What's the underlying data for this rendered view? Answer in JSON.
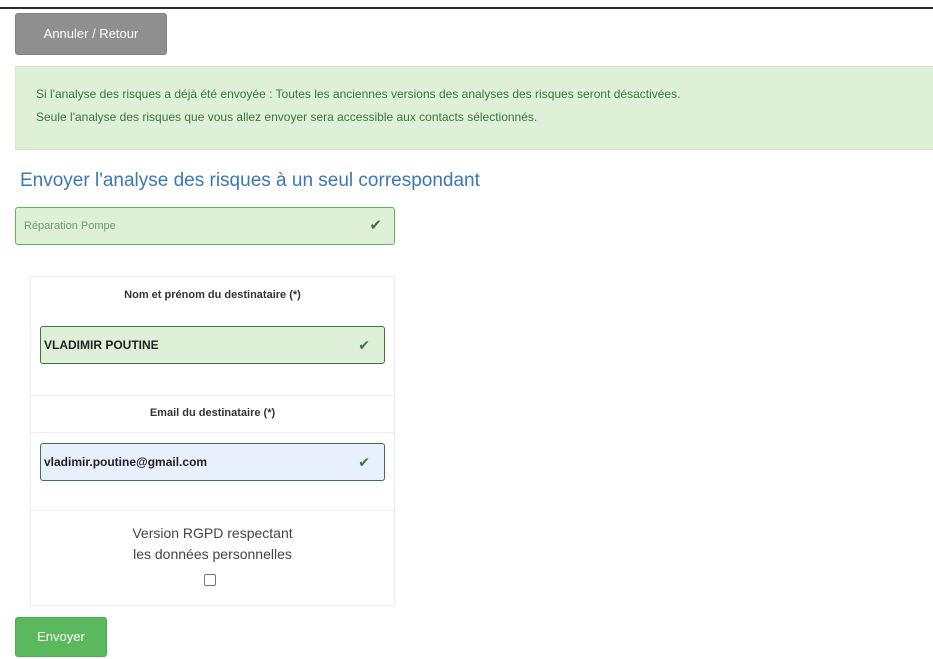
{
  "header": {
    "back_button_label": "Annuler / Retour"
  },
  "alert": {
    "line1": "Si l'analyse des risques a déjà été envoyée : Toutes les anciennes versions des analyses des risques seront désactivées.",
    "line2": "Seule l'analyse des risques que vous allez envoyer sera accessible aux contacts sélectionnés."
  },
  "section": {
    "title": "Envoyer l'analyse des risques à un seul correspondant"
  },
  "project_select": {
    "selected_value": "Réparation Pompe",
    "check_icon": "✔"
  },
  "form": {
    "name_label": "Nom et prénom du destinataire (*)",
    "name_value": "VLADIMIR POUTINE",
    "email_label": "Email du destinataire (*)",
    "email_value": "vladimir.poutine@gmail.com",
    "check_icon": "✔",
    "rgpd_line1": "Version RGPD respectant",
    "rgpd_line2": "les données personnelles",
    "rgpd_checked": false
  },
  "actions": {
    "send_button_label": "Envoyer"
  },
  "colors": {
    "alert_background": "#dff0d8",
    "alert_text": "#3c763d",
    "title": "#3a78b6",
    "success_button": "#5cb85c",
    "back_button": "#8f8f8f",
    "autofill_background": "#e8f0fe"
  }
}
